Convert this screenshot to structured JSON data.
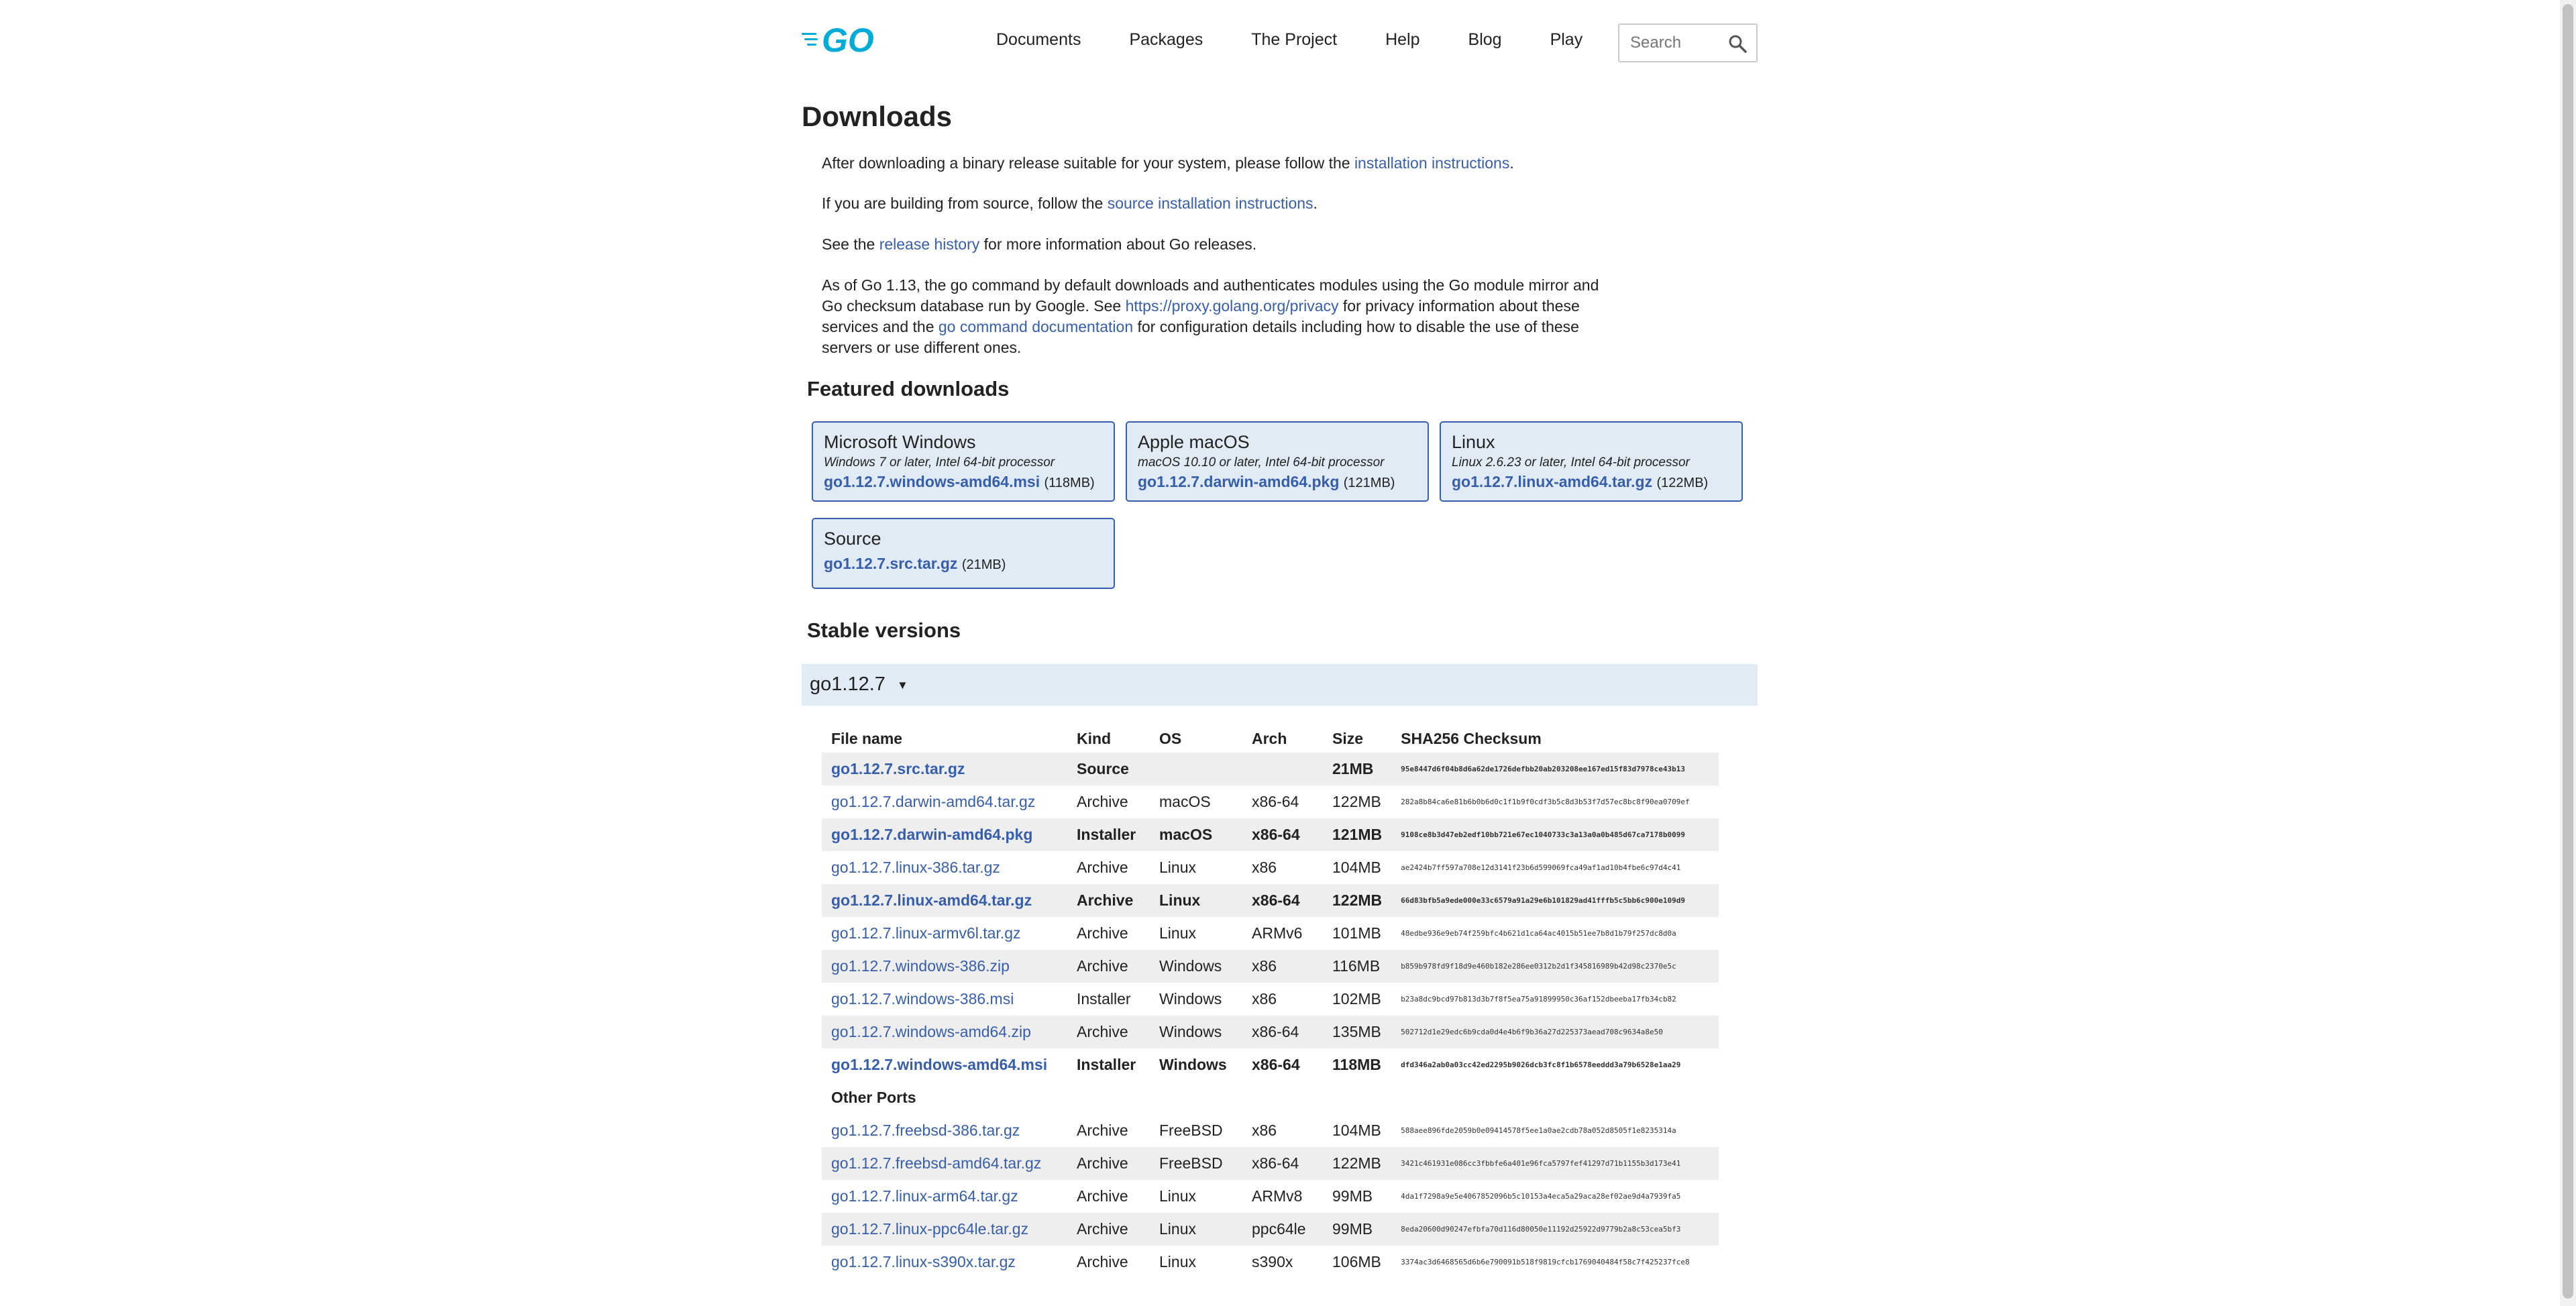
{
  "nav": {
    "items": [
      "Documents",
      "Packages",
      "The Project",
      "Help",
      "Blog",
      "Play"
    ],
    "search_placeholder": "Search"
  },
  "page_title": "Downloads",
  "intro": {
    "p1_pre": "After downloading a binary release suitable for your system, please follow the ",
    "p1_link": "installation instructions",
    "p1_post": ".",
    "p2_pre": "If you are building from source, follow the ",
    "p2_link": "source installation instructions",
    "p2_post": ".",
    "p3_pre": "See the ",
    "p3_link": "release history",
    "p3_post": " for more information about Go releases.",
    "p4_a": "As of Go 1.13, the go command by default downloads and authenticates modules using the Go module mirror and Go checksum database run by Google. See ",
    "p4_link1": "https://proxy.golang.org/privacy",
    "p4_b": " for privacy information about these services and the ",
    "p4_link2": "go command documentation",
    "p4_c": " for configuration details including how to disable the use of these servers or use different ones."
  },
  "featured": {
    "heading": "Featured downloads",
    "items": [
      {
        "platform": "Microsoft Windows",
        "reqs": "Windows 7 or later, Intel 64-bit processor",
        "file": "go1.12.7.windows-amd64.msi",
        "size": "(118MB)"
      },
      {
        "platform": "Apple macOS",
        "reqs": "macOS 10.10 or later, Intel 64-bit processor",
        "file": "go1.12.7.darwin-amd64.pkg",
        "size": "(121MB)"
      },
      {
        "platform": "Linux",
        "reqs": "Linux 2.6.23 or later, Intel 64-bit processor",
        "file": "go1.12.7.linux-amd64.tar.gz",
        "size": "(122MB)"
      },
      {
        "platform": "Source",
        "reqs": "",
        "file": "go1.12.7.src.tar.gz",
        "size": "(21MB)"
      }
    ]
  },
  "stable": {
    "heading": "Stable versions",
    "version": "go1.12.7",
    "arrow": "▼",
    "columns": [
      "File name",
      "Kind",
      "OS",
      "Arch",
      "Size",
      "SHA256 Checksum"
    ],
    "other_ports_label": "Other Ports",
    "rows": [
      {
        "file": "go1.12.7.src.tar.gz",
        "kind": "Source",
        "os": "",
        "arch": "",
        "size": "21MB",
        "sha": "95e8447d6f04b8d6a62de1726defbb20ab203208ee167ed15f83d7978ce43b13",
        "highlight": true,
        "alt": true
      },
      {
        "file": "go1.12.7.darwin-amd64.tar.gz",
        "kind": "Archive",
        "os": "macOS",
        "arch": "x86-64",
        "size": "122MB",
        "sha": "282a8b84ca6e81b6b0b6d0c1f1b9f0cdf3b5c8d3b53f7d57ec8bc8f90ea0709ef",
        "highlight": false,
        "alt": false
      },
      {
        "file": "go1.12.7.darwin-amd64.pkg",
        "kind": "Installer",
        "os": "macOS",
        "arch": "x86-64",
        "size": "121MB",
        "sha": "9108ce8b3d47eb2edf10bb721e67ec1040733c3a13a0a0b485d67ca7178b0099",
        "highlight": true,
        "alt": true
      },
      {
        "file": "go1.12.7.linux-386.tar.gz",
        "kind": "Archive",
        "os": "Linux",
        "arch": "x86",
        "size": "104MB",
        "sha": "ae2424b7ff597a708e12d3141f23b6d599069fca49af1ad10b4fbe6c97d4c41",
        "highlight": false,
        "alt": false
      },
      {
        "file": "go1.12.7.linux-amd64.tar.gz",
        "kind": "Archive",
        "os": "Linux",
        "arch": "x86-64",
        "size": "122MB",
        "sha": "66d83bfb5a9ede000e33c6579a91a29e6b101829ad41fffb5c5bb6c900e109d9",
        "highlight": true,
        "alt": true
      },
      {
        "file": "go1.12.7.linux-armv6l.tar.gz",
        "kind": "Archive",
        "os": "Linux",
        "arch": "ARMv6",
        "size": "101MB",
        "sha": "48edbe936e9eb74f259bfc4b621d1ca64ac4015b51ee7b8d1b79f257dc8d0a",
        "highlight": false,
        "alt": false
      },
      {
        "file": "go1.12.7.windows-386.zip",
        "kind": "Archive",
        "os": "Windows",
        "arch": "x86",
        "size": "116MB",
        "sha": "b859b978fd9f18d9e460b182e286ee0312b2d1f345816989b42d98c2370e5c",
        "highlight": false,
        "alt": true
      },
      {
        "file": "go1.12.7.windows-386.msi",
        "kind": "Installer",
        "os": "Windows",
        "arch": "x86",
        "size": "102MB",
        "sha": "b23a8dc9bcd97b813d3b7f8f5ea75a91899950c36af152dbeeba17fb34cb82",
        "highlight": false,
        "alt": false
      },
      {
        "file": "go1.12.7.windows-amd64.zip",
        "kind": "Archive",
        "os": "Windows",
        "arch": "x86-64",
        "size": "135MB",
        "sha": "502712d1e29edc6b9cda0d4e4b6f9b36a27d225373aead708c9634a8e50",
        "highlight": false,
        "alt": true
      },
      {
        "file": "go1.12.7.windows-amd64.msi",
        "kind": "Installer",
        "os": "Windows",
        "arch": "x86-64",
        "size": "118MB",
        "sha": "dfd346a2ab0a03cc42ed2295b9026dcb3fc8f1b6578eeddd3a79b6528e1aa29",
        "highlight": true,
        "alt": false
      }
    ],
    "other_rows": [
      {
        "file": "go1.12.7.freebsd-386.tar.gz",
        "kind": "Archive",
        "os": "FreeBSD",
        "arch": "x86",
        "size": "104MB",
        "sha": "588aee896fde2059b0e09414578f5ee1a0ae2cdb78a052d8505f1e8235314a",
        "alt": false
      },
      {
        "file": "go1.12.7.freebsd-amd64.tar.gz",
        "kind": "Archive",
        "os": "FreeBSD",
        "arch": "x86-64",
        "size": "122MB",
        "sha": "3421c461931e086cc3fbbfe6a401e96fca5797fef41297d71b1155b3d173e41",
        "alt": true
      },
      {
        "file": "go1.12.7.linux-arm64.tar.gz",
        "kind": "Archive",
        "os": "Linux",
        "arch": "ARMv8",
        "size": "99MB",
        "sha": "4da1f7298a9e5e4067852096b5c10153a4eca5a29aca28ef02ae9d4a7939fa5",
        "alt": false
      },
      {
        "file": "go1.12.7.linux-ppc64le.tar.gz",
        "kind": "Archive",
        "os": "Linux",
        "arch": "ppc64le",
        "size": "99MB",
        "sha": "8eda20600d90247efbfa70d116d80050e11192d25922d9779b2a8c53cea5bf3",
        "alt": true
      },
      {
        "file": "go1.12.7.linux-s390x.tar.gz",
        "kind": "Archive",
        "os": "Linux",
        "arch": "s390x",
        "size": "106MB",
        "sha": "3374ac3d6468565d6b6e790091b518f9819cfcb1769040484f58c7f425237fce8",
        "alt": false
      }
    ]
  },
  "colors": {
    "link": "#375eab",
    "featured_bg": "#e0ebf5",
    "row_alt": "#eeeeee"
  },
  "icons": {
    "logo": "go-logo",
    "search": "search-icon"
  }
}
